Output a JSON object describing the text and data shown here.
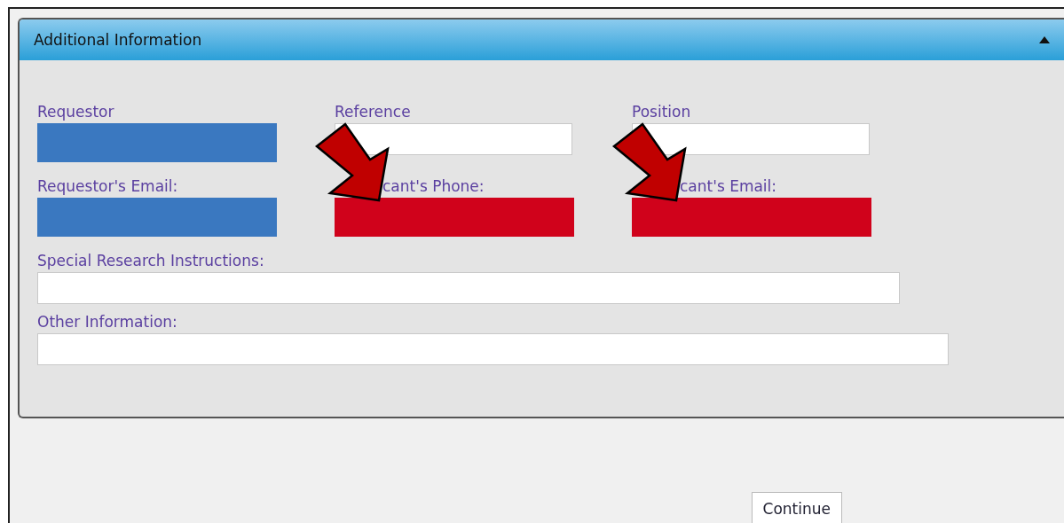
{
  "panel": {
    "title": "Additional Information",
    "expanded": true
  },
  "rows": [
    {
      "fields": [
        {
          "label": "Requestor",
          "color": "#3a78c0"
        },
        {
          "label": "Reference"
        },
        {
          "label": "Position"
        }
      ]
    },
    {
      "fields": [
        {
          "label": "Requestor's Email:",
          "color": "#3a78c0"
        },
        {
          "label": "cant's Phone:",
          "color": "#d0021b",
          "arrow": true
        },
        {
          "label": "cant's Email:",
          "color": "#d0021b",
          "arrow": true
        }
      ]
    }
  ],
  "wide_fields": [
    {
      "label": "Special Research Instructions:"
    },
    {
      "label": "Other Information:"
    }
  ],
  "buttons": [
    "Continue"
  ]
}
